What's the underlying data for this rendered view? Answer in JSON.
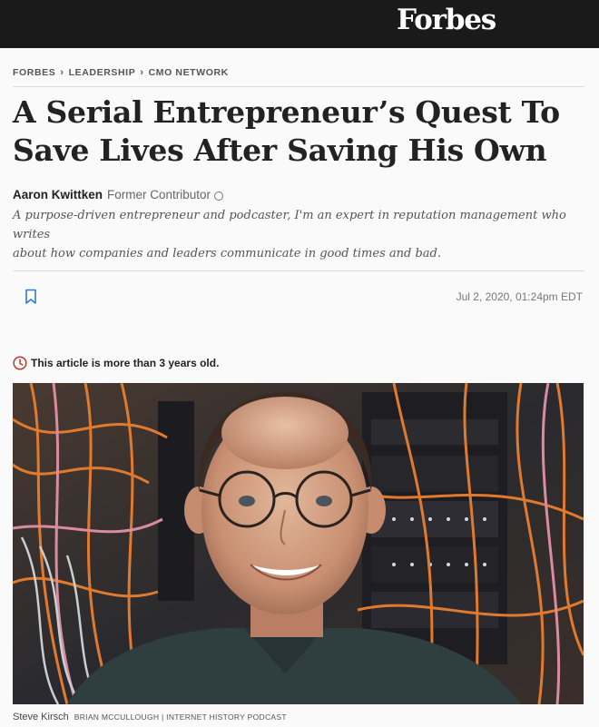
{
  "header": {
    "logo": "Forbes"
  },
  "breadcrumb": {
    "items": [
      "FORBES",
      "LEADERSHIP",
      "CMO NETWORK"
    ]
  },
  "article": {
    "headline_line1": "A Serial Entrepreneur’s Quest To",
    "headline_line2": "Save Lives After Saving His Own",
    "author_name": "Aaron Kwittken",
    "author_role": "Former Contributor",
    "bio_line1": "A purpose-driven entrepreneur and podcaster, I'm an expert in reputation management who writes",
    "bio_line2": "about how companies and leaders communicate in good times and bad.",
    "date": "Jul 2, 2020, 01:24pm EDT",
    "age_notice": "This article is more than 3 years old.",
    "caption_name": "Steve Kirsch",
    "caption_credit": "BRIAN MCCULLOUGH | INTERNET HISTORY PODCAST"
  },
  "icons": {
    "bookmark": "bookmark-icon",
    "clock": "clock-icon",
    "info": "info-icon"
  },
  "colors": {
    "topbar": "#1a1a1a",
    "notice_icon": "#c0392b",
    "bookmark_icon": "#2f7bd1"
  }
}
